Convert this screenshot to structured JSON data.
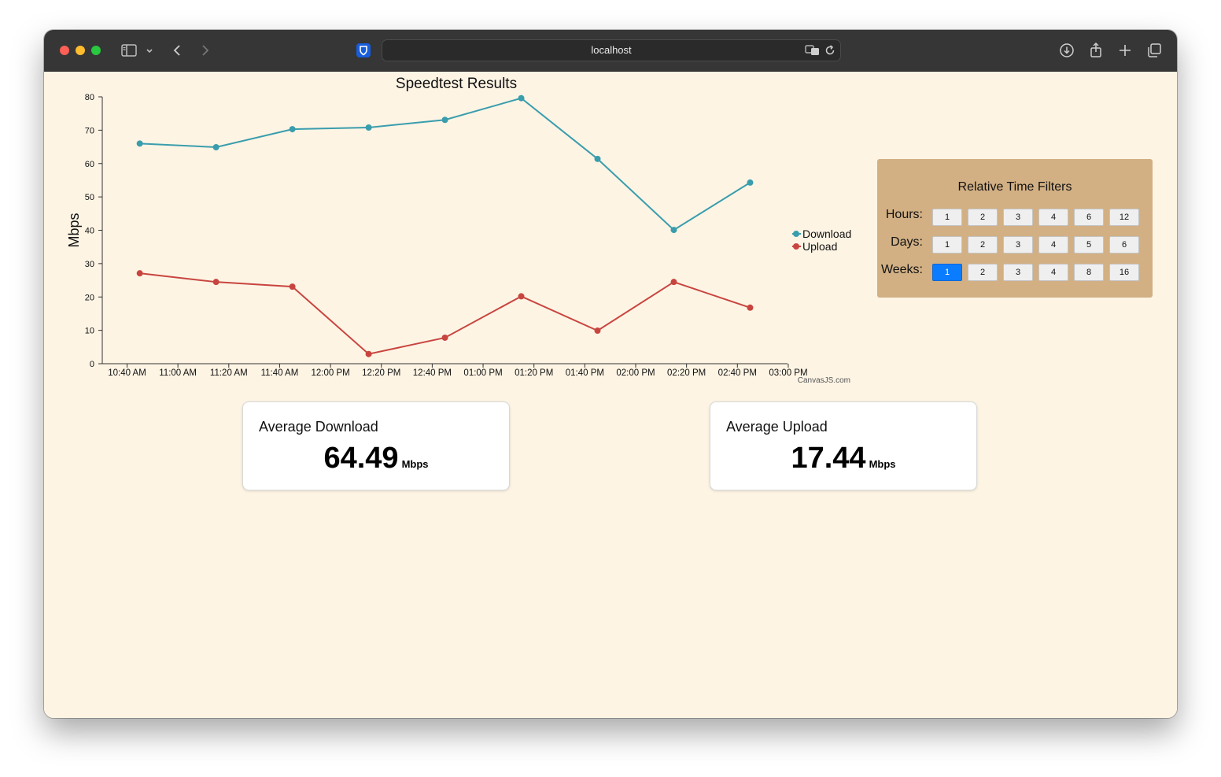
{
  "browser": {
    "address": "localhost"
  },
  "chart_data": {
    "type": "line",
    "title": "Speedtest Results",
    "ylabel": "Mbps",
    "xlabel": "",
    "ylim": [
      0,
      80
    ],
    "yticks": [
      0,
      10,
      20,
      30,
      40,
      50,
      60,
      70,
      80
    ],
    "xticks": [
      "10:40 AM",
      "11:00 AM",
      "11:20 AM",
      "11:40 AM",
      "12:00 PM",
      "12:20 PM",
      "12:40 PM",
      "01:00 PM",
      "01:20 PM",
      "01:40 PM",
      "02:00 PM",
      "02:20 PM",
      "02:40 PM",
      "03:00 PM"
    ],
    "x": [
      "10:45 AM",
      "11:15 AM",
      "11:45 AM",
      "12:15 PM",
      "12:45 PM",
      "01:15 PM",
      "01:45 PM",
      "02:15 PM",
      "02:45 PM"
    ],
    "series": [
      {
        "name": "Download",
        "color": "#3a9dad",
        "values": [
          66.0,
          64.9,
          70.3,
          70.8,
          73.1,
          79.6,
          61.4,
          40.1,
          54.3
        ]
      },
      {
        "name": "Upload",
        "color": "#c8453f",
        "values": [
          27.1,
          24.5,
          23.1,
          2.9,
          7.8,
          20.2,
          9.9,
          24.5,
          16.8
        ]
      }
    ],
    "legend": "right",
    "credit": "CanvasJS.com"
  },
  "filters": {
    "title": "Relative Time Filters",
    "rows": [
      {
        "label": "Hours:",
        "options": [
          "1",
          "2",
          "3",
          "4",
          "6",
          "12"
        ],
        "selected": -1
      },
      {
        "label": "Days:",
        "options": [
          "1",
          "2",
          "3",
          "4",
          "5",
          "6"
        ],
        "selected": -1
      },
      {
        "label": "Weeks:",
        "options": [
          "1",
          "2",
          "3",
          "4",
          "8",
          "16"
        ],
        "selected": 0
      }
    ],
    "active_color": "#0a7cff"
  },
  "stats": {
    "download": {
      "title": "Average Download",
      "value": "64.49",
      "unit": "Mbps"
    },
    "upload": {
      "title": "Average Upload",
      "value": "17.44",
      "unit": "Mbps"
    }
  }
}
